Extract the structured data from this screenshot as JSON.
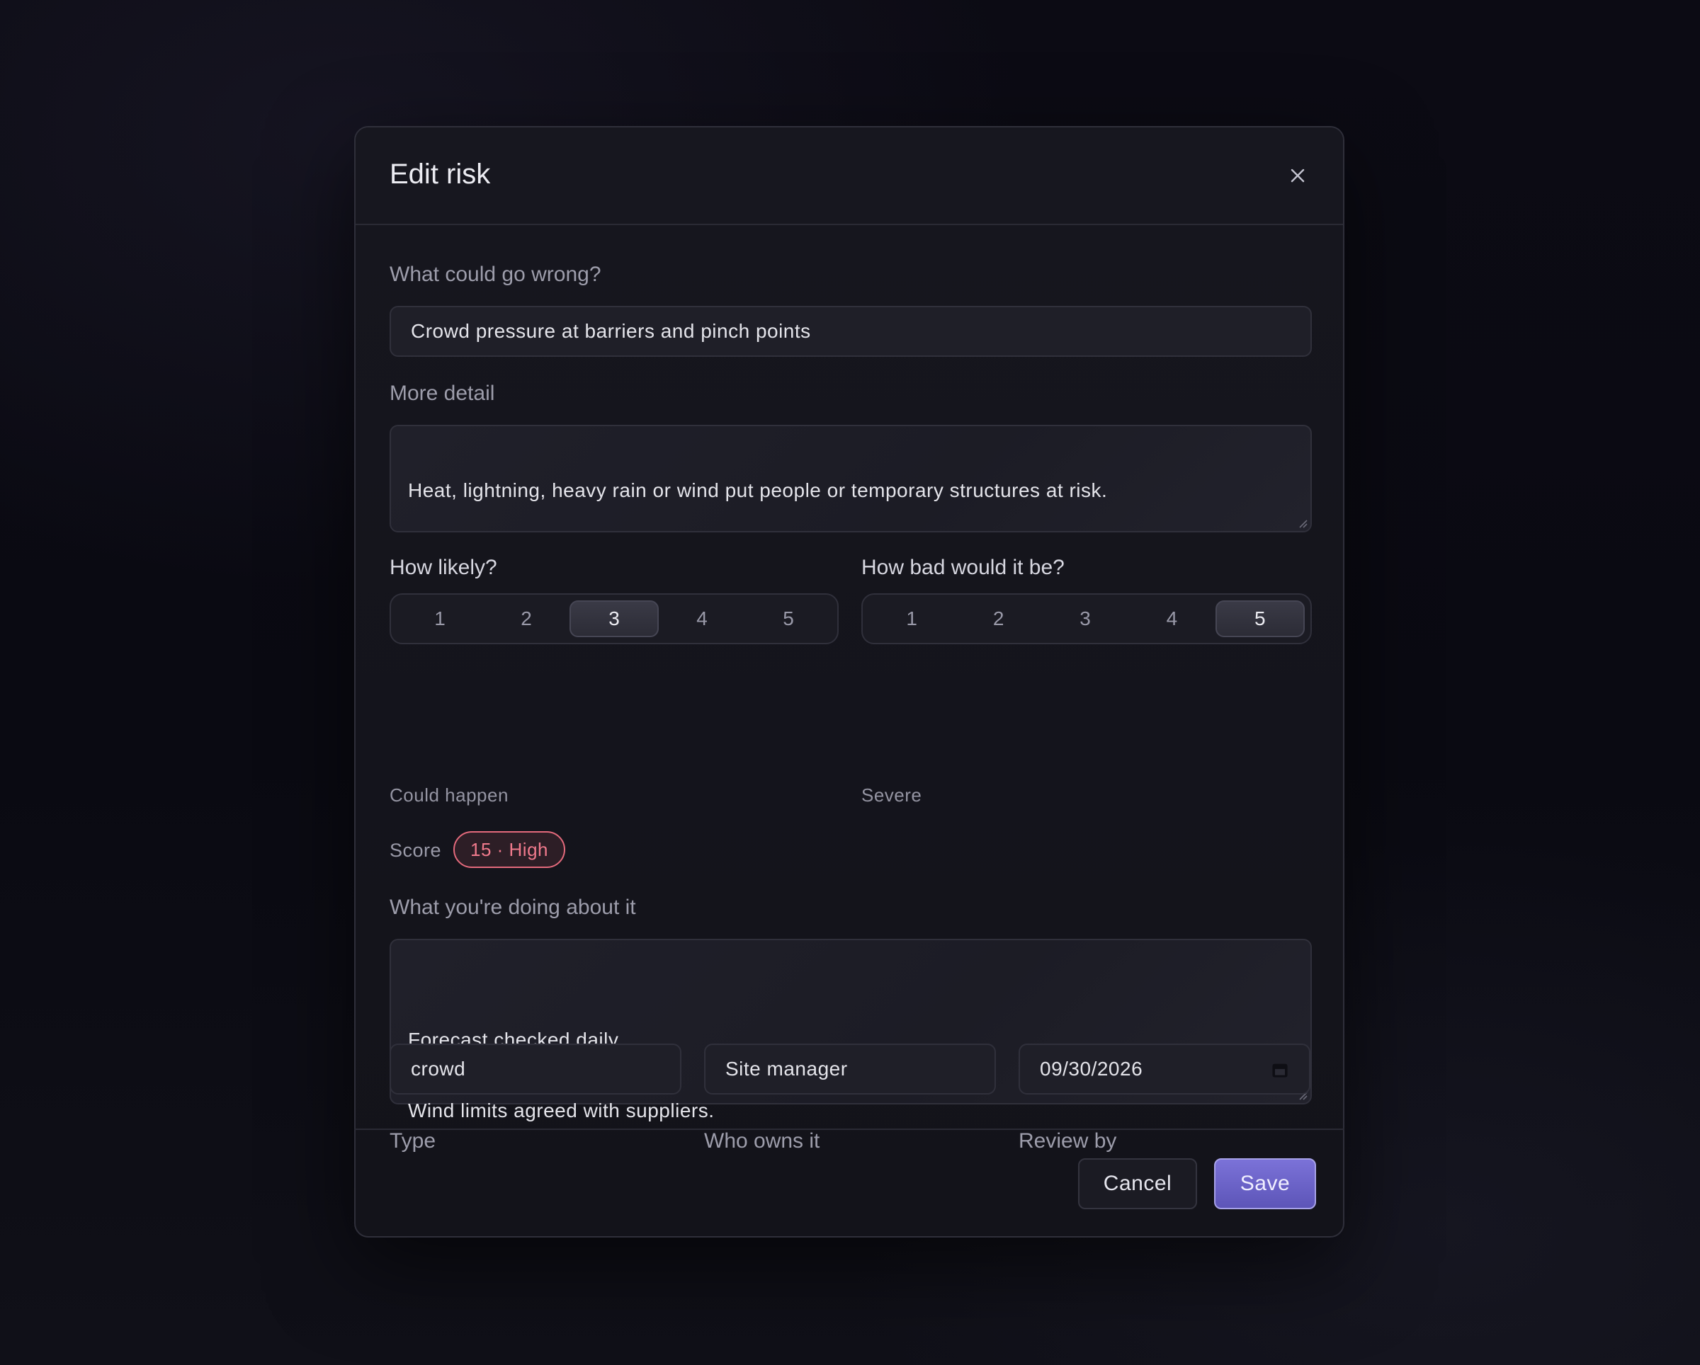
{
  "dialog": {
    "title": "Edit risk",
    "close_label": "×"
  },
  "form": {
    "risk_label": "What could go wrong?",
    "risk_value": "Crowd pressure at barriers and pinch points",
    "detail_label": "More detail",
    "detail_value": "Heat, lightning, heavy rain or wind put people or temporary structures at risk.",
    "likelihood": {
      "label": "How likely?",
      "options": [
        "1",
        "2",
        "3",
        "4",
        "5"
      ],
      "selected": "3",
      "hint": "Could happen"
    },
    "severity": {
      "label": "How bad would it be?",
      "options": [
        "1",
        "2",
        "3",
        "4",
        "5"
      ],
      "selected": "5",
      "hint": "Severe"
    },
    "score": {
      "label": "Score",
      "value": "15 · High",
      "color": "#f07a8c"
    },
    "mitigation_label": "What you're doing about it",
    "mitigation_lines": [
      "Forecast checked daily.",
      "Wind limits agreed with suppliers."
    ],
    "type_label": "Type",
    "type_value": "crowd",
    "owner_label": "Who owns it",
    "owner_value": "Site manager",
    "review_label": "Review by",
    "review_value": "09/30/2026",
    "review_icon": "calendar-icon"
  },
  "footer": {
    "cancel_label": "Cancel",
    "save_label": "Save"
  },
  "colors": {
    "accent": "#6e66cc",
    "high_risk": "#e46a7c",
    "background": "#0b0b12"
  }
}
